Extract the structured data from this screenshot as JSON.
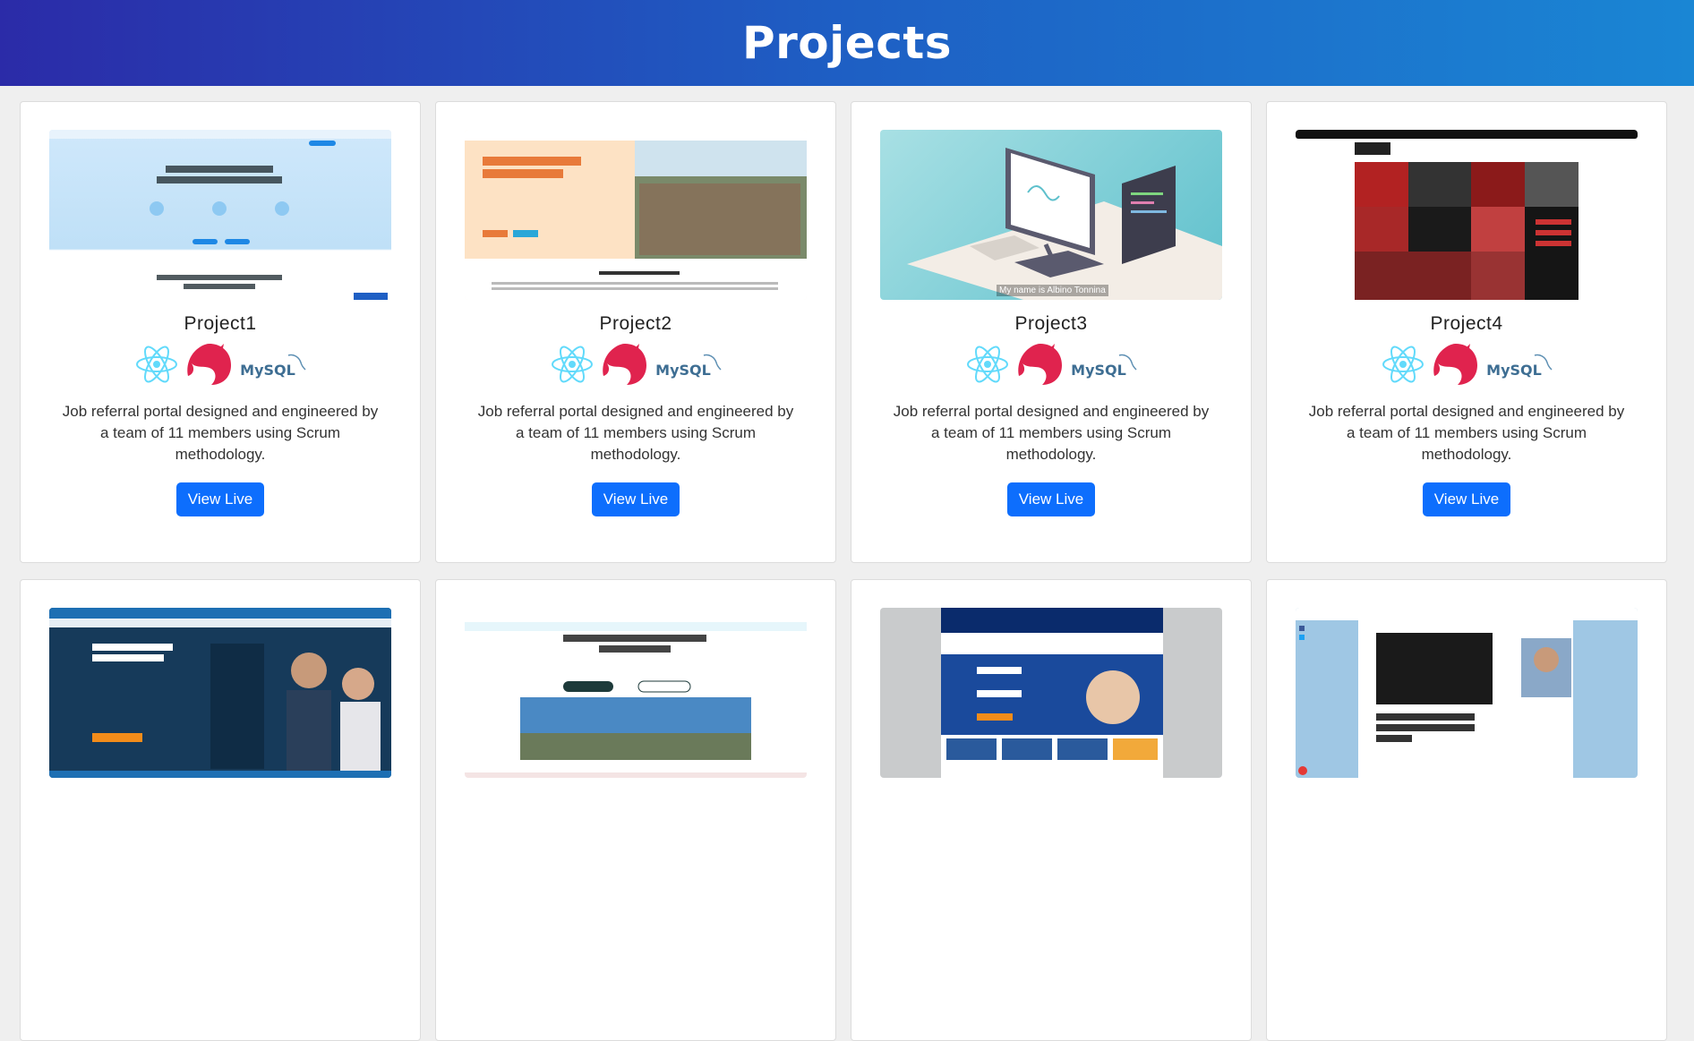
{
  "page": {
    "title": "Projects"
  },
  "projects": [
    {
      "title": "Project1",
      "description": "Job referral portal designed and engineered by a team of 11 members using Scrum methodology.",
      "button": "View Live",
      "tech": [
        "react-icon",
        "nestjs-icon",
        "mysql-icon"
      ],
      "tech_labels": {
        "mysql": "MySQL"
      }
    },
    {
      "title": "Project2",
      "description": "Job referral portal designed and engineered by a team of 11 members using Scrum methodology.",
      "button": "View Live",
      "tech": [
        "react-icon",
        "nestjs-icon",
        "mysql-icon"
      ],
      "tech_labels": {
        "mysql": "MySQL"
      }
    },
    {
      "title": "Project3",
      "description": "Job referral portal designed and engineered by a team of 11 members using Scrum methodology.",
      "button": "View Live",
      "tech": [
        "react-icon",
        "nestjs-icon",
        "mysql-icon"
      ],
      "tech_labels": {
        "mysql": "MySQL"
      },
      "thumbnail_caption": "My name is Albino Tonnina"
    },
    {
      "title": "Project4",
      "description": "Job referral portal designed and engineered by a team of 11 members using Scrum methodology.",
      "button": "View Live",
      "tech": [
        "react-icon",
        "nestjs-icon",
        "mysql-icon"
      ],
      "tech_labels": {
        "mysql": "MySQL"
      }
    }
  ],
  "thumbnails_row2": [
    {
      "name": "clicks-it-recruitment-screenshot"
    },
    {
      "name": "sydney-recruitment-agency-screenshot"
    },
    {
      "name": "hays-recruitment-screenshot"
    },
    {
      "name": "remoteflyer-blog-screenshot"
    }
  ],
  "colors": {
    "header_start": "#2b2ba8",
    "header_end": "#1a86d4",
    "button": "#0d6efd",
    "react": "#61dafb",
    "nestjs": "#e0234e",
    "mysql": "#3e6e93"
  }
}
